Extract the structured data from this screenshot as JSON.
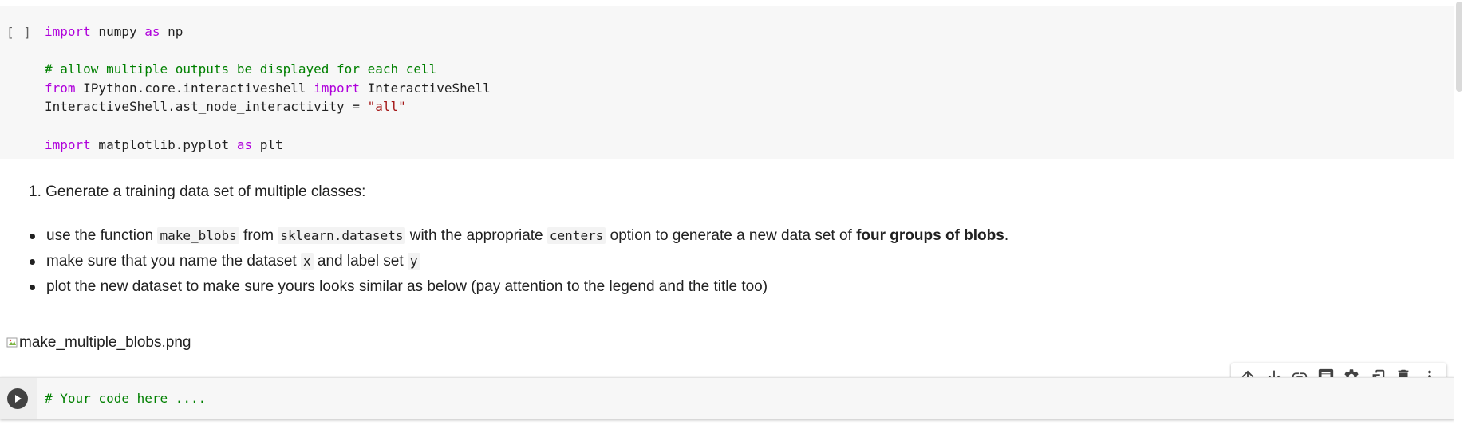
{
  "cell1": {
    "execution_count": "[ ]",
    "lines": [
      [
        {
          "t": "import",
          "c": "kw"
        },
        {
          "t": " numpy ",
          "c": ""
        },
        {
          "t": "as",
          "c": "kw"
        },
        {
          "t": " np",
          "c": ""
        }
      ],
      [],
      [
        {
          "t": "# allow multiple outputs be displayed for each cell",
          "c": "cm"
        }
      ],
      [
        {
          "t": "from",
          "c": "kw"
        },
        {
          "t": " IPython.core.interactiveshell ",
          "c": ""
        },
        {
          "t": "import",
          "c": "kw"
        },
        {
          "t": " InteractiveShell",
          "c": ""
        }
      ],
      [
        {
          "t": "InteractiveShell.ast_node_interactivity = ",
          "c": ""
        },
        {
          "t": "\"all\"",
          "c": "st"
        }
      ],
      [],
      [
        {
          "t": "import",
          "c": "kw"
        },
        {
          "t": " matplotlib.pyplot ",
          "c": ""
        },
        {
          "t": "as",
          "c": "kw"
        },
        {
          "t": " plt",
          "c": ""
        }
      ]
    ]
  },
  "markdown": {
    "ordered_item": "1. Generate a training data set of multiple classes:",
    "bullets": [
      {
        "p1": "use the function ",
        "code1": "make_blobs",
        "p2": " from ",
        "code2": "sklearn.datasets",
        "p3": " with the appropriate ",
        "code3": "centers",
        "p4": " option to generate a new data set of ",
        "bold": "four groups of blobs",
        "p5": "."
      },
      {
        "p1": "make sure that you name the dataset ",
        "code1": "x",
        "p2": " and label set ",
        "code2": "y"
      },
      {
        "p1": "plot the new dataset to make sure yours looks similar as below (pay attention to the legend and the title too)"
      }
    ],
    "image_alt": "make_multiple_blobs.png"
  },
  "cell2": {
    "code": "# Your code here ...."
  },
  "toolbar": {
    "icons": [
      "arrow-up-icon",
      "arrow-down-icon",
      "link-icon",
      "comment-icon",
      "gear-icon",
      "mirror-cell-icon",
      "trash-icon",
      "more-vert-icon"
    ]
  },
  "colors": {
    "keyword": "#af00db",
    "comment": "#008000",
    "string": "#a31515",
    "cell_bg": "#f7f7f7"
  }
}
